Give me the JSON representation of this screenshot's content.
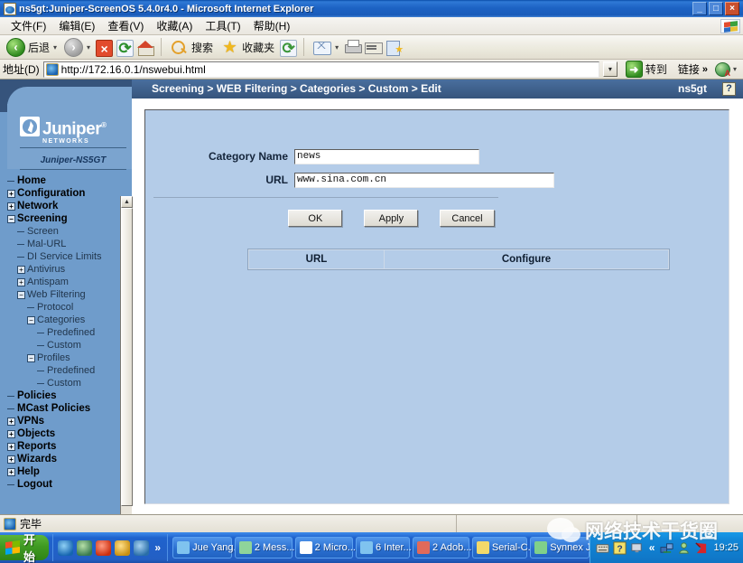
{
  "window": {
    "title": "ns5gt:Juniper-ScreenOS 5.4.0r4.0 - Microsoft Internet Explorer",
    "minimize_label": "_",
    "maximize_label": "□",
    "close_label": "×"
  },
  "menu": {
    "items": [
      "文件(F)",
      "编辑(E)",
      "查看(V)",
      "收藏(A)",
      "工具(T)",
      "帮助(H)"
    ]
  },
  "toolbar": {
    "back_label": "后退",
    "forward_label": "",
    "search_label": "搜索",
    "favorites_label": "收藏夹",
    "dropdown_caret": "▾",
    "icons": {
      "back": "back-icon",
      "forward": "forward-icon",
      "stop": "stop-icon",
      "refresh": "refresh-icon",
      "home": "home-icon",
      "search": "search-icon",
      "favorites": "star-icon",
      "history": "history-icon",
      "mail": "mail-icon",
      "print": "print-icon",
      "edit": "edit-icon",
      "discuss": "discuss-icon"
    }
  },
  "address": {
    "label": "地址(D)",
    "url": "http://172.16.0.1/nswebui.html",
    "dropdown_caret": "▾",
    "go_label": "转到",
    "go_arrow": "➜",
    "links_label": "链接",
    "links_chevron": "»",
    "globe_caret": "▾"
  },
  "page": {
    "breadcrumb": "Screening > WEB Filtering > Categories > Custom > Edit",
    "device_name": "ns5gt",
    "help_label": "?"
  },
  "branding": {
    "name": "Juniper",
    "registered": "®",
    "tagline": "NETWORKS",
    "model": "Juniper-NS5GT"
  },
  "nav": {
    "items": [
      {
        "label": "Home",
        "level": 0,
        "toggle": "none"
      },
      {
        "label": "Configuration",
        "level": 0,
        "toggle": "plus"
      },
      {
        "label": "Network",
        "level": 0,
        "toggle": "plus"
      },
      {
        "label": "Screening",
        "level": 0,
        "toggle": "minus"
      },
      {
        "label": "Screen",
        "level": 1,
        "toggle": "none"
      },
      {
        "label": "Mal-URL",
        "level": 1,
        "toggle": "none"
      },
      {
        "label": "DI Service Limits",
        "level": 1,
        "toggle": "none"
      },
      {
        "label": "Antivirus",
        "level": 1,
        "toggle": "plus"
      },
      {
        "label": "Antispam",
        "level": 1,
        "toggle": "plus"
      },
      {
        "label": "Web Filtering",
        "level": 1,
        "toggle": "minus"
      },
      {
        "label": "Protocol",
        "level": 2,
        "toggle": "none"
      },
      {
        "label": "Categories",
        "level": 2,
        "toggle": "minus"
      },
      {
        "label": "Predefined",
        "level": 3,
        "toggle": "none"
      },
      {
        "label": "Custom",
        "level": 3,
        "toggle": "none"
      },
      {
        "label": "Profiles",
        "level": 2,
        "toggle": "minus"
      },
      {
        "label": "Predefined",
        "level": 3,
        "toggle": "none"
      },
      {
        "label": "Custom",
        "level": 3,
        "toggle": "none"
      },
      {
        "label": "Policies",
        "level": 0,
        "toggle": "none"
      },
      {
        "label": "MCast Policies",
        "level": 0,
        "toggle": "none"
      },
      {
        "label": "VPNs",
        "level": 0,
        "toggle": "plus"
      },
      {
        "label": "Objects",
        "level": 0,
        "toggle": "plus"
      },
      {
        "label": "Reports",
        "level": 0,
        "toggle": "plus"
      },
      {
        "label": "Wizards",
        "level": 0,
        "toggle": "plus"
      },
      {
        "label": "Help",
        "level": 0,
        "toggle": "plus"
      },
      {
        "label": "Logout",
        "level": 0,
        "toggle": "none"
      }
    ],
    "scroll_up": "▲",
    "scroll_down": "▼"
  },
  "form": {
    "category_name_label": "Category Name",
    "category_name_value": "news",
    "url_label": "URL",
    "url_value": "www.sina.com.cn",
    "buttons": [
      {
        "label": "OK"
      },
      {
        "label": "Apply"
      },
      {
        "label": "Cancel"
      }
    ]
  },
  "table": {
    "columns": [
      "URL",
      "Configure"
    ],
    "rows": []
  },
  "statusbar": {
    "text": "完毕"
  },
  "taskbar": {
    "start_label": "开始",
    "quicklaunch_chevron": "»",
    "tasks": [
      {
        "label": "Jue Yang...",
        "has_caret": false
      },
      {
        "label": "2 Mess...",
        "has_caret": true
      },
      {
        "label": "2 Micro...",
        "has_caret": true
      },
      {
        "label": "6 Inter...",
        "has_caret": true
      },
      {
        "label": "2 Adob...",
        "has_caret": true
      },
      {
        "label": "Serial-C...",
        "has_caret": false
      },
      {
        "label": "Synnex J...",
        "has_caret": false
      }
    ],
    "tray_chevron": "«",
    "clock": "19:25"
  },
  "watermark": {
    "text": "网络技术干货圈"
  },
  "colors": {
    "titlebar_blue": "#1d63c4",
    "page_header_blue": "#3f618d",
    "sidebar_blue": "#6f9ccb",
    "content_blue": "#b4cce8",
    "taskbar_blue": "#235fc4",
    "start_green": "#3f9a22"
  }
}
